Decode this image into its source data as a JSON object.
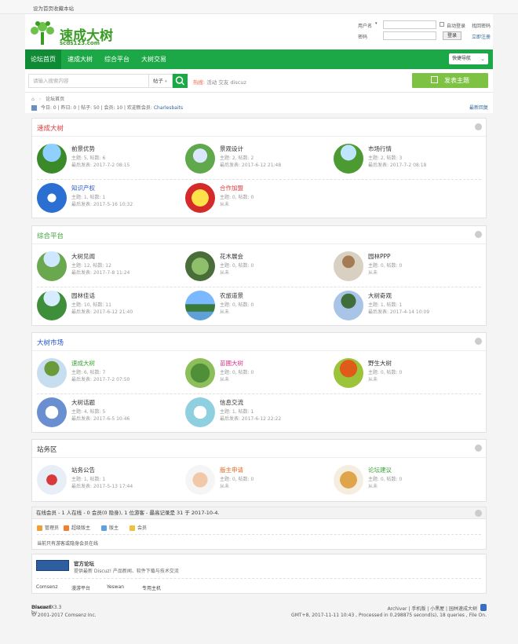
{
  "topbar": {
    "set_home": "设为首页",
    "bookmark": "收藏本站"
  },
  "logo": {
    "name": "速成大树",
    "sub": "scds123.com"
  },
  "login": {
    "username_label": "用户名",
    "password_label": "密码",
    "auto_login": "自动登录",
    "forgot": "找回密码",
    "submit": "登录",
    "register": "立即注册"
  },
  "nav": {
    "items": [
      "论坛首页",
      "速成大树",
      "综合平台",
      "大树交易"
    ],
    "quick": "快捷导航"
  },
  "search": {
    "placeholder": "请输入搜索内容",
    "type": "帖子",
    "hot_label": "热搜:",
    "hot": [
      "活动",
      "交友",
      "discuz"
    ],
    "post_button": "发表主题"
  },
  "crumb": {
    "home": "论坛首页",
    "stats": "今日: 0 | 昨日: 0 | 帖子: 50 | 会员: 10 | 欢迎新会员:",
    "new_member": "Charlesbaits",
    "latest": "最新回复"
  },
  "colors": {
    "brand": "#1ca846",
    "section1": "#e23a3a",
    "section2": "#3aa235",
    "section3": "#2255cc"
  },
  "sections": [
    {
      "title": "速成大树",
      "forums": [
        {
          "name": "前景优势",
          "counts": "主题: 5, 帖数: 6",
          "last": "最后发表: 2017-7-2 08:15"
        },
        {
          "name": "景观设计",
          "counts": "主题: 2, 帖数: 2",
          "last": "最后发表: 2017-6-12 21:48"
        },
        {
          "name": "市场行情",
          "counts": "主题: 2, 帖数: 3",
          "last": "最后发表: 2017-7-2 08:18"
        },
        {
          "name": "知识产权",
          "counts": "主题: 1, 帖数: 1",
          "last": "最后发表: 2017-5-16 10:32"
        },
        {
          "name": "合作加盟",
          "counts": "主题: 0, 帖数: 0",
          "last": "从未"
        }
      ]
    },
    {
      "title": "综合平台",
      "forums": [
        {
          "name": "大树见闻",
          "counts": "主题: 12, 帖数: 12",
          "last": "最后发表: 2017-7-8 11:24"
        },
        {
          "name": "花木展会",
          "counts": "主题: 0, 帖数: 0",
          "last": "从未"
        },
        {
          "name": "园林PPP",
          "counts": "主题: 0, 帖数: 0",
          "last": "从未"
        },
        {
          "name": "园林佳话",
          "counts": "主题: 10, 帖数: 11",
          "last": "最后发表: 2017-6-12 21:40"
        },
        {
          "name": "农旅道景",
          "counts": "主题: 0, 帖数: 0",
          "last": "从未"
        },
        {
          "name": "大树奇观",
          "counts": "主题: 1, 帖数: 1",
          "last": "最后发表: 2017-4-14 10:09"
        }
      ]
    },
    {
      "title": "大树市场",
      "forums": [
        {
          "name": "速成大树",
          "counts": "主题: 6, 帖数: 7",
          "last": "最后发表: 2017-7-2 07:50"
        },
        {
          "name": "苗圃大树",
          "counts": "主题: 0, 帖数: 0",
          "last": "从未"
        },
        {
          "name": "野生大树",
          "counts": "主题: 0, 帖数: 0",
          "last": "从未"
        },
        {
          "name": "大树话题",
          "counts": "主题: 4, 帖数: 5",
          "last": "最后发表: 2017-6-5 10:46"
        },
        {
          "name": "信息交流",
          "counts": "主题: 1, 帖数: 1",
          "last": "最后发表: 2017-6-12 22:22"
        }
      ]
    },
    {
      "title": "站务区",
      "forums": [
        {
          "name": "站务公告",
          "counts": "主题: 1, 帖数: 1",
          "last": "最后发表: 2017-5-13 17:44"
        },
        {
          "name": "版主申请",
          "counts": "主题: 0, 帖数: 0",
          "last": "从未"
        },
        {
          "name": "论坛建议",
          "counts": "主题: 0, 帖数: 0",
          "last": "从未"
        }
      ]
    }
  ],
  "online": {
    "summary": "在线会员 - 1 人在线 - 0 会员(0 隐身), 1 位游客 - 最高记录是 31 于 2017-10-4.",
    "legend": [
      "管理员",
      "超级版主",
      "版主",
      "会员"
    ],
    "note": "当前只有游客或隐身会员在线"
  },
  "links": {
    "official_title": "官方论坛",
    "official_desc": "提供最新 Discuz! 产品新闻、软件下载与技术交流",
    "items": [
      "Comsenz",
      "漫游平台",
      "Yeswan",
      "专用主机"
    ]
  },
  "footer": {
    "powered": "Powered by",
    "brand": "Discuz!",
    "version": "X3.3",
    "copyright": "© 2001-2017 Comsenz Inc.",
    "links": "Archiver | 手机版 | 小黑屋 | 园林速成大树",
    "stats": "GMT+8, 2017-11-11 10:43 , Processed in 0.298875 second(s), 18 queries , File On."
  }
}
